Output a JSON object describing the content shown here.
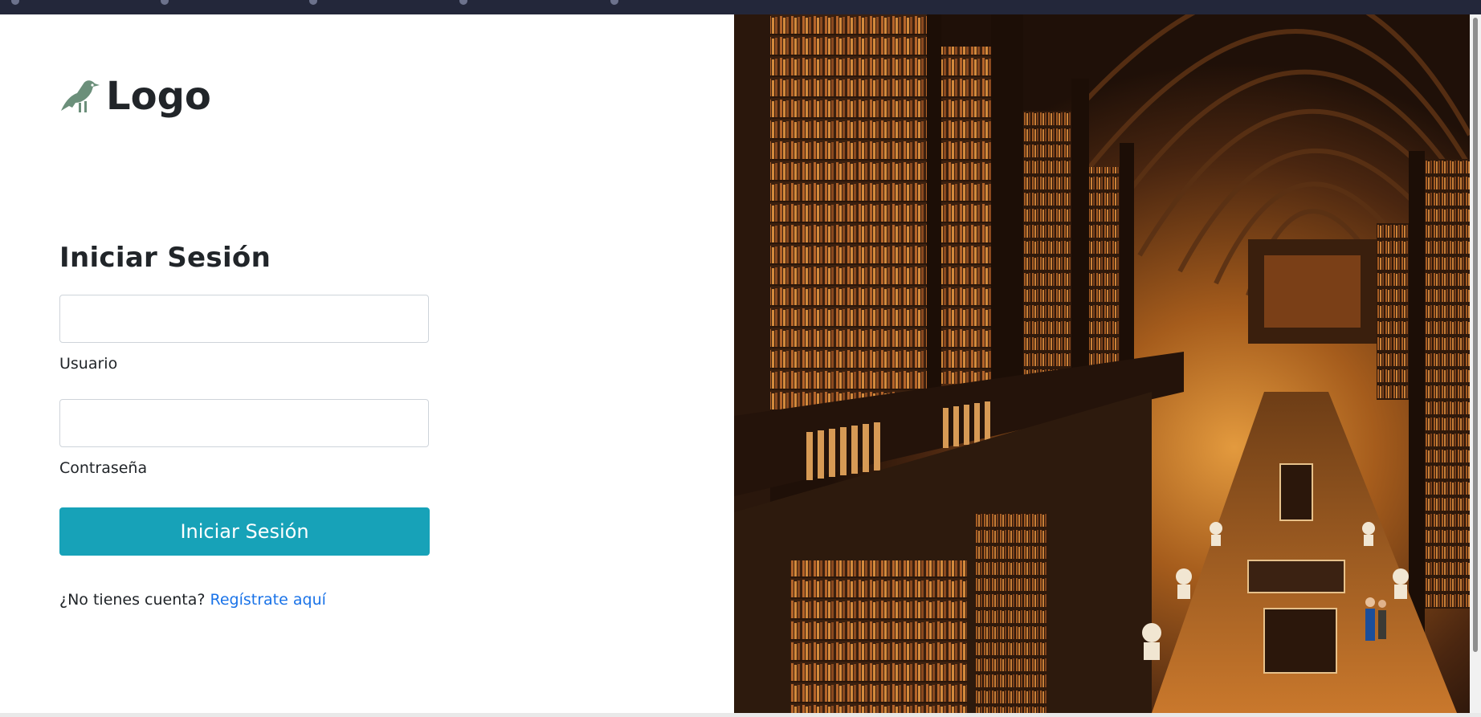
{
  "brand": {
    "logo_text": "Logo",
    "logo_icon": "raven-icon",
    "icon_color": "#6b8f7a"
  },
  "login": {
    "title": "Iniciar Sesión",
    "username_label": "Usuario",
    "username_value": "",
    "password_label": "Contraseña",
    "password_value": "",
    "submit_label": "Iniciar Sesión",
    "signup_prompt": "¿No tienes cuenta?",
    "signup_link": "Regístrate aquí"
  },
  "colors": {
    "accent": "#17a2b8",
    "link": "#1a73e8",
    "text": "#212529"
  }
}
